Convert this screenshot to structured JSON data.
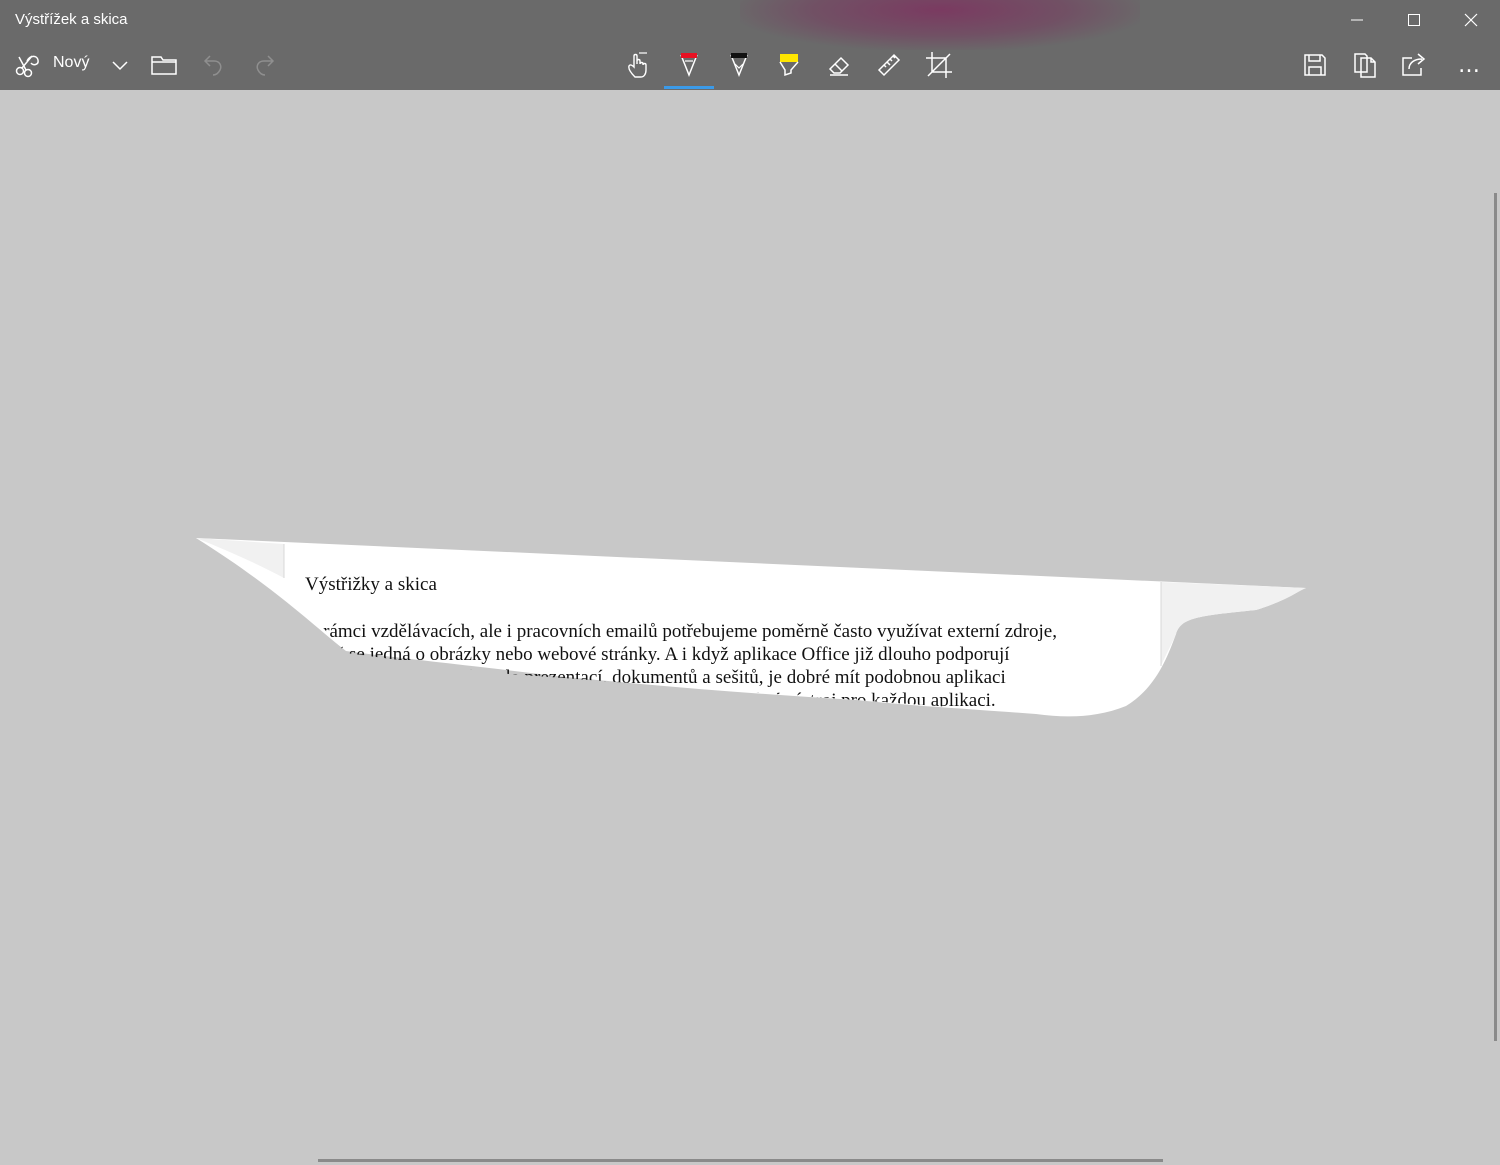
{
  "window": {
    "title": "Výstřížek a skica",
    "controls": [
      "minimize",
      "maximize",
      "close"
    ]
  },
  "toolbar": {
    "new_label": "Nový",
    "left_tools": [
      "new-snip-icon",
      "chevron-down-icon",
      "open-folder-icon",
      "undo-icon",
      "redo-icon"
    ],
    "center_tools": [
      "touch-writing-icon",
      "ballpoint-pen-icon",
      "pencil-icon",
      "highlighter-icon",
      "eraser-icon",
      "ruler-icon",
      "crop-icon"
    ],
    "active_tool": "ballpoint-pen",
    "right_tools": [
      "save-icon",
      "copy-icon",
      "share-icon"
    ],
    "more_label": "…",
    "accent_color": "#3b9ae8"
  },
  "document": {
    "heading": "Výstřižky a skica",
    "lines": [
      "V rámci vzdělávacích, ale i pracovních emailů potřebujeme poměrně často využívat externí zdroje,",
      "ať už se jedná o obrázky nebo webové stránky. A i když aplikace Office již dlouho podporují",
      "vkládání výstřižků přímo do prezentací, dokumentů a sešitů, je dobré mít podobnou aplikaci",
      "k dispozici i samostatně, abychom nemuseli otevírat konkrétní nástroj pro každou aplikaci."
    ]
  },
  "colors": {
    "titlebar": "#6a6a6a",
    "canvas": "#c8c8c8",
    "pen_red": "#e81123",
    "highlighter_yellow": "#ffe600"
  }
}
